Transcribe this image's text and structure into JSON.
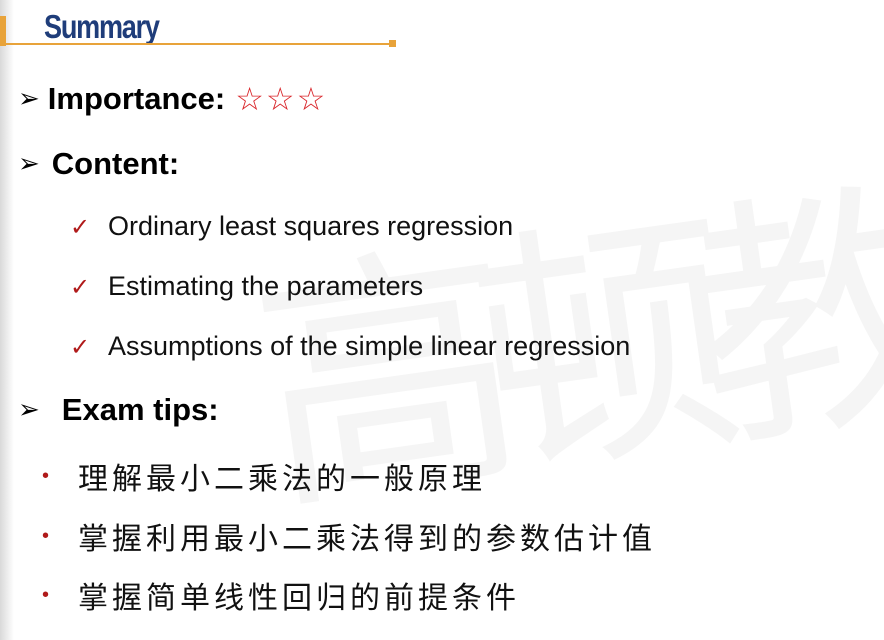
{
  "slide": {
    "title": "Summary",
    "importance_label": "Importance:",
    "importance_stars": "☆☆☆",
    "content_label": "Content:",
    "content_items": [
      "Ordinary least squares regression",
      "Estimating the parameters",
      "Assumptions of the simple linear regression"
    ],
    "exam_label": "Exam tips:",
    "exam_items": [
      "理解最小二乘法的一般原理",
      "掌握利用最小二乘法得到的参数估计值",
      "掌握简单线性回归的前提条件"
    ],
    "watermark": "高顿教"
  },
  "icons": {
    "arrow": "arrow-bullet-icon",
    "check": "checkmark-icon",
    "dot": "dot-bullet-icon"
  },
  "colors": {
    "title": "#1f3d7a",
    "accent": "#e8a33a",
    "star": "#d9262b",
    "check": "#b01a1a"
  }
}
